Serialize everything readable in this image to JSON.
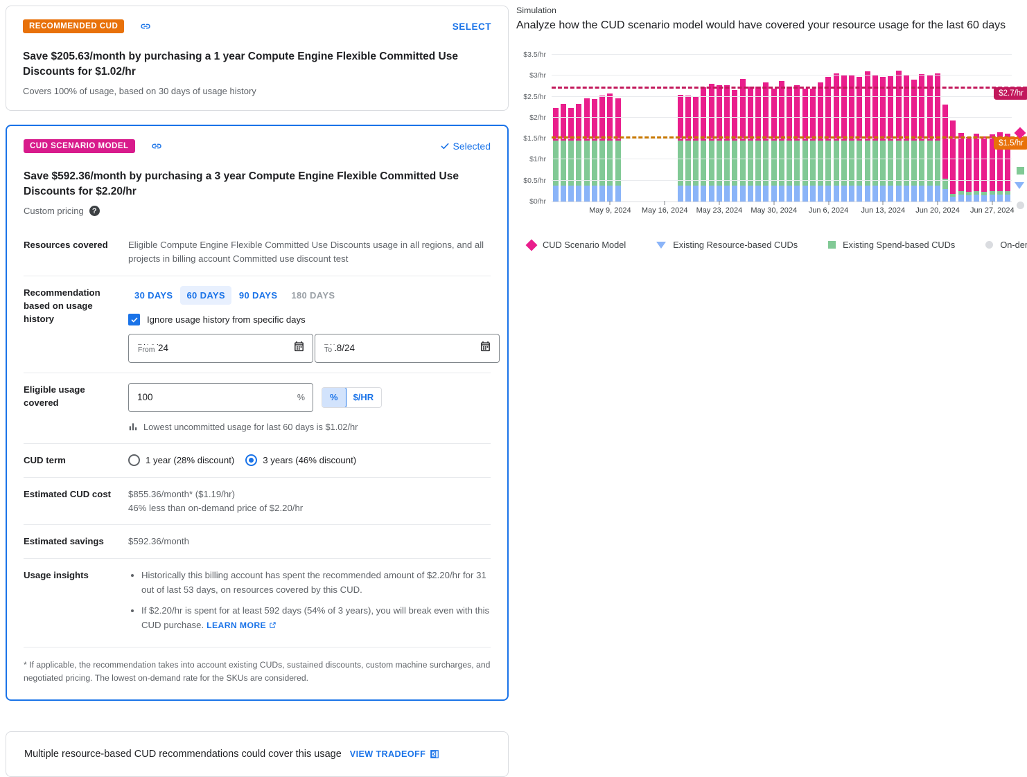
{
  "recommended_card": {
    "chip": "RECOMMENDED CUD",
    "link_icon": "link-icon",
    "action": "SELECT",
    "title": "Save $205.63/month by purchasing a 1 year Compute Engine Flexible Committed Use Discounts for $1.02/hr",
    "subtitle": "Covers 100% of usage, based on 30 days of usage history"
  },
  "scenario_card": {
    "chip": "CUD SCENARIO MODEL",
    "link_icon": "link-icon",
    "action": "Selected",
    "title": "Save $592.36/month by purchasing a 3 year Compute Engine Flexible Committed Use Discounts for $2.20/hr",
    "subtitle": "Custom pricing",
    "help_glyph": "?",
    "rows": {
      "resources_covered_label": "Resources covered",
      "resources_covered_value": "Eligible Compute Engine Flexible Committed Use Discounts usage in all regions, and all projects in billing account Committed use discount test",
      "history_label": "Recommendation based on usage history",
      "day_tabs": [
        {
          "label": "30 DAYS",
          "state": "normal"
        },
        {
          "label": "60 DAYS",
          "state": "active"
        },
        {
          "label": "90 DAYS",
          "state": "normal"
        },
        {
          "label": "180 DAYS",
          "state": "disabled"
        }
      ],
      "ignore_checkbox_label": "Ignore usage history from specific days",
      "ignore_checked": true,
      "from_legend": "From",
      "from_value": "5/12/24",
      "to_legend": "To",
      "to_value": "5/18/24",
      "eligible_label": "Eligible usage covered",
      "eligible_value": "100",
      "eligible_suffix": "%",
      "unit_toggle": [
        {
          "label": "%",
          "selected": true
        },
        {
          "label": "$/HR",
          "selected": false
        }
      ],
      "eligible_hint": "Lowest uncommitted usage for last 60 days is $1.02/hr",
      "term_label": "CUD term",
      "term_options": [
        {
          "label": "1 year (28% discount)",
          "selected": false
        },
        {
          "label": "3 years (46% discount)",
          "selected": true
        }
      ],
      "cost_label": "Estimated CUD cost",
      "cost_value_line1": "$855.36/month* ($1.19/hr)",
      "cost_value_line2": "46% less than on-demand price of $2.20/hr",
      "savings_label": "Estimated savings",
      "savings_value": "$592.36/month",
      "insights_label": "Usage insights",
      "insights": [
        "Historically this billing account has spent the recommended amount of $2.20/hr for 31 out of last 53 days, on resources covered by this CUD.",
        "If $2.20/hr is spent for at least 592 days (54% of 3 years), you will break even with this CUD purchase."
      ],
      "learn_more": "LEARN MORE"
    },
    "footnote": "* If applicable, the recommendation takes into account existing CUDs, sustained discounts, custom machine surcharges, and negotiated pricing. The lowest on-demand rate for the SKUs are considered."
  },
  "bottom_bar": {
    "text": "Multiple resource-based CUD recommendations could cover this usage",
    "action": "VIEW TRADEOFF"
  },
  "simulation": {
    "label": "Simulation",
    "title": "Analyze how the CUD scenario model would have covered your resource usage for the last 60 days"
  },
  "chart_data": {
    "type": "bar",
    "stacked": true,
    "title": "Analyze how the CUD scenario model would have covered your resource usage for the last 60 days",
    "xlabel": "",
    "ylabel": "",
    "ylim": [
      0,
      3.75
    ],
    "grid": true,
    "legend_position": "bottom",
    "y_ticks": [
      "$0/hr",
      "$0.5/hr",
      "$1/hr",
      "$1.5/hr",
      "$2/hr",
      "$2.5/hr",
      "$3/hr",
      "$3.5/hr"
    ],
    "y_tick_values": [
      0,
      0.5,
      1,
      1.5,
      2,
      2.5,
      3,
      3.5
    ],
    "x_ticks": [
      "May 9, 2024",
      "May 16, 2024",
      "May 23, 2024",
      "May 30, 2024",
      "Jun 6, 2024",
      "Jun 13, 2024",
      "Jun 20, 2024",
      "Jun 27, 2024"
    ],
    "x_tick_positions": [
      7,
      14,
      21,
      28,
      35,
      42,
      49,
      56
    ],
    "series": [
      {
        "name": "Existing Resource-based CUDs",
        "color": "#8ab4f8",
        "marker": "triangle-down"
      },
      {
        "name": "Existing Spend-based CUDs",
        "color": "#81c995",
        "marker": "square"
      },
      {
        "name": "CUD Scenario Model",
        "color": "#e91e8c",
        "marker": "diamond"
      },
      {
        "name": "On-demand price",
        "color": "#dadce0",
        "marker": "circle"
      }
    ],
    "reference_lines": [
      {
        "label": "$2.7/hr",
        "value": 2.7,
        "color": "#c2185b",
        "style": "dashed"
      },
      {
        "label": "$1.5/hr",
        "value": 1.5,
        "color": "#c77700",
        "style": "dashed"
      }
    ],
    "bars": [
      {
        "blue": 0.38,
        "green": 1.07,
        "pink": 0.78
      },
      {
        "blue": 0.38,
        "green": 1.07,
        "pink": 0.88
      },
      {
        "blue": 0.38,
        "green": 1.07,
        "pink": 0.78
      },
      {
        "blue": 0.38,
        "green": 1.07,
        "pink": 0.88
      },
      {
        "blue": 0.38,
        "green": 1.07,
        "pink": 1.02
      },
      {
        "blue": 0.38,
        "green": 1.07,
        "pink": 1.0
      },
      {
        "blue": 0.38,
        "green": 1.07,
        "pink": 1.08
      },
      {
        "blue": 0.38,
        "green": 1.07,
        "pink": 1.12
      },
      {
        "blue": 0.38,
        "green": 1.07,
        "pink": 1.02
      },
      null,
      null,
      null,
      null,
      null,
      null,
      null,
      {
        "blue": 0.38,
        "green": 1.07,
        "pink": 1.09
      },
      {
        "blue": 0.38,
        "green": 1.07,
        "pink": 1.08
      },
      {
        "blue": 0.38,
        "green": 1.07,
        "pink": 1.04
      },
      {
        "blue": 0.38,
        "green": 1.07,
        "pink": 1.27
      },
      {
        "blue": 0.38,
        "green": 1.07,
        "pink": 1.36
      },
      {
        "blue": 0.38,
        "green": 1.07,
        "pink": 1.33
      },
      {
        "blue": 0.38,
        "green": 1.07,
        "pink": 1.32
      },
      {
        "blue": 0.38,
        "green": 1.07,
        "pink": 1.21
      },
      {
        "blue": 0.38,
        "green": 1.07,
        "pink": 1.48
      },
      {
        "blue": 0.38,
        "green": 1.07,
        "pink": 1.29
      },
      {
        "blue": 0.38,
        "green": 1.07,
        "pink": 1.29
      },
      {
        "blue": 0.38,
        "green": 1.07,
        "pink": 1.4
      },
      {
        "blue": 0.38,
        "green": 1.07,
        "pink": 1.25
      },
      {
        "blue": 0.38,
        "green": 1.07,
        "pink": 1.42
      },
      {
        "blue": 0.38,
        "green": 1.07,
        "pink": 1.29
      },
      {
        "blue": 0.38,
        "green": 1.07,
        "pink": 1.32
      },
      {
        "blue": 0.38,
        "green": 1.07,
        "pink": 1.25
      },
      {
        "blue": 0.38,
        "green": 1.07,
        "pink": 1.24
      },
      {
        "blue": 0.38,
        "green": 1.07,
        "pink": 1.4
      },
      {
        "blue": 0.38,
        "green": 1.07,
        "pink": 1.53
      },
      {
        "blue": 0.38,
        "green": 1.07,
        "pink": 1.6
      },
      {
        "blue": 0.38,
        "green": 1.07,
        "pink": 1.55
      },
      {
        "blue": 0.38,
        "green": 1.07,
        "pink": 1.57
      },
      {
        "blue": 0.38,
        "green": 1.07,
        "pink": 1.52
      },
      {
        "blue": 0.38,
        "green": 1.07,
        "pink": 1.65
      },
      {
        "blue": 0.38,
        "green": 1.07,
        "pink": 1.57
      },
      {
        "blue": 0.38,
        "green": 1.07,
        "pink": 1.53
      },
      {
        "blue": 0.38,
        "green": 1.07,
        "pink": 1.54
      },
      {
        "blue": 0.38,
        "green": 1.07,
        "pink": 1.67
      },
      {
        "blue": 0.38,
        "green": 1.07,
        "pink": 1.56
      },
      {
        "blue": 0.38,
        "green": 1.07,
        "pink": 1.45
      },
      {
        "blue": 0.38,
        "green": 1.07,
        "pink": 1.59
      },
      {
        "blue": 0.38,
        "green": 1.07,
        "pink": 1.57
      },
      {
        "blue": 0.38,
        "green": 1.07,
        "pink": 1.6
      },
      {
        "blue": 0.3,
        "green": 0.24,
        "pink": 1.78
      },
      {
        "blue": 0.12,
        "green": 0.06,
        "pink": 1.75
      },
      {
        "blue": 0.16,
        "green": 0.09,
        "pink": 1.38
      },
      {
        "blue": 0.15,
        "green": 0.08,
        "pink": 1.3
      },
      {
        "blue": 0.16,
        "green": 0.09,
        "pink": 1.37
      },
      {
        "blue": 0.15,
        "green": 0.08,
        "pink": 1.32
      },
      {
        "blue": 0.16,
        "green": 0.09,
        "pink": 1.36
      },
      {
        "blue": 0.16,
        "green": 0.09,
        "pink": 1.41
      },
      {
        "blue": 0.16,
        "green": 0.09,
        "pink": 1.37
      }
    ]
  },
  "legend": [
    {
      "label": "CUD Scenario Model",
      "marker": "diamond-icon",
      "color": "#e91e8c"
    },
    {
      "label": "Existing Resource-based CUDs",
      "marker": "triangle-down-icon",
      "color": "#8ab4f8"
    },
    {
      "label": "Existing Spend-based CUDs",
      "marker": "square-icon",
      "color": "#81c995"
    },
    {
      "label": "On-demand price",
      "marker": "circle-icon",
      "color": "#dadce0"
    }
  ]
}
